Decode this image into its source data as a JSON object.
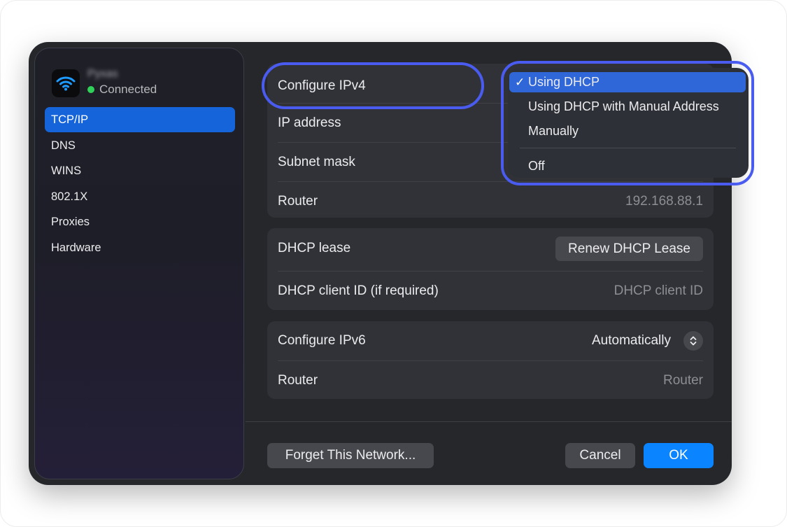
{
  "colors": {
    "accent": "#0a84ff",
    "selection": "#1664d9",
    "connected": "#30d158",
    "highlight": "#4a5cf0"
  },
  "network": {
    "name": "Pyxas",
    "status": "Connected",
    "icon": "wifi-icon"
  },
  "sidebar": {
    "items": [
      {
        "label": "TCP/IP",
        "selected": true
      },
      {
        "label": "DNS"
      },
      {
        "label": "WINS"
      },
      {
        "label": "802.1X"
      },
      {
        "label": "Proxies"
      },
      {
        "label": "Hardware"
      }
    ]
  },
  "ipv4": {
    "configure_label": "Configure IPv4",
    "ip_label": "IP address",
    "subnet_label": "Subnet mask",
    "router_label": "Router",
    "router_value": "192.168.88.1"
  },
  "dhcp": {
    "lease_label": "DHCP lease",
    "renew_button": "Renew DHCP Lease",
    "client_id_label": "DHCP client ID (if required)",
    "client_id_placeholder": "DHCP client ID"
  },
  "ipv6": {
    "configure_label": "Configure IPv6",
    "configure_value": "Automatically",
    "router_label": "Router",
    "router_placeholder": "Router"
  },
  "dropdown": {
    "check": "✓",
    "options": [
      "Using DHCP",
      "Using DHCP with Manual Address",
      "Manually",
      "Off"
    ],
    "selected_index": 0
  },
  "footer": {
    "forget": "Forget This Network...",
    "cancel": "Cancel",
    "ok": "OK"
  }
}
